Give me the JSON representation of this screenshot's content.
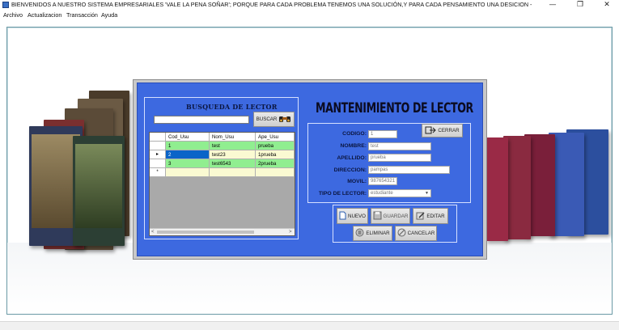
{
  "window": {
    "title": "BIENVENIDOS A NUESTRO SISTEMA EMPRESARIALES 'VALE LA PENA SOÑAR'; PORQUE PARA CADA PROBLEMA TENEMOS UNA SOLUCIÓN,Y PARA CADA PENSAMIENTO UNA DESICION  -",
    "minimize": "—",
    "restore": "❐",
    "close": "✕"
  },
  "menu": {
    "items": [
      "Archivo",
      "Actualizacion",
      "Transacción",
      "Ayuda"
    ]
  },
  "search": {
    "title": "BUSQUEDA DE LECTOR",
    "input_value": "",
    "button_label": "BUSCAR",
    "button_icon": "binoculars-icon"
  },
  "grid": {
    "columns": [
      "Cod_Usu",
      "Nom_Usu",
      "Ape_Usu"
    ],
    "rows": [
      {
        "cod": "1",
        "nom": "test",
        "ape": "prueba",
        "selected": false
      },
      {
        "cod": "2",
        "nom": "test23",
        "ape": "1prueba",
        "selected": true
      },
      {
        "cod": "3",
        "nom": "test6543",
        "ape": "2prueba",
        "selected": false
      }
    ],
    "new_row_marker": "*",
    "current_row_marker": "▸"
  },
  "form": {
    "title": "MANTENIMIENTO DE LECTOR",
    "close_button": "CERRAR",
    "fields": {
      "codigo": {
        "label": "CODIGO:",
        "value": "1"
      },
      "nombre": {
        "label": "NOMBRE:",
        "value": "test"
      },
      "apellido": {
        "label": "APELLIDO:",
        "value": "prueba"
      },
      "direccion": {
        "label": "DIRECCION:",
        "value": "pampas"
      },
      "movil": {
        "label": "MOVIL:",
        "value": "987654321"
      },
      "tipo": {
        "label": "TIPO DE LECTOR:",
        "value": "estudiante"
      }
    }
  },
  "actions": {
    "nuevo": "NUEVO",
    "guardar": "GUARDAR",
    "editar": "EDITAR",
    "eliminar": "ELIMINAR",
    "cancelar": "CANCELAR"
  },
  "colors": {
    "form_background": "#3d69e0",
    "grid_row_green": "#90ee90",
    "grid_row_yellow": "#fafad2",
    "grid_selected": "#0a64c8"
  }
}
